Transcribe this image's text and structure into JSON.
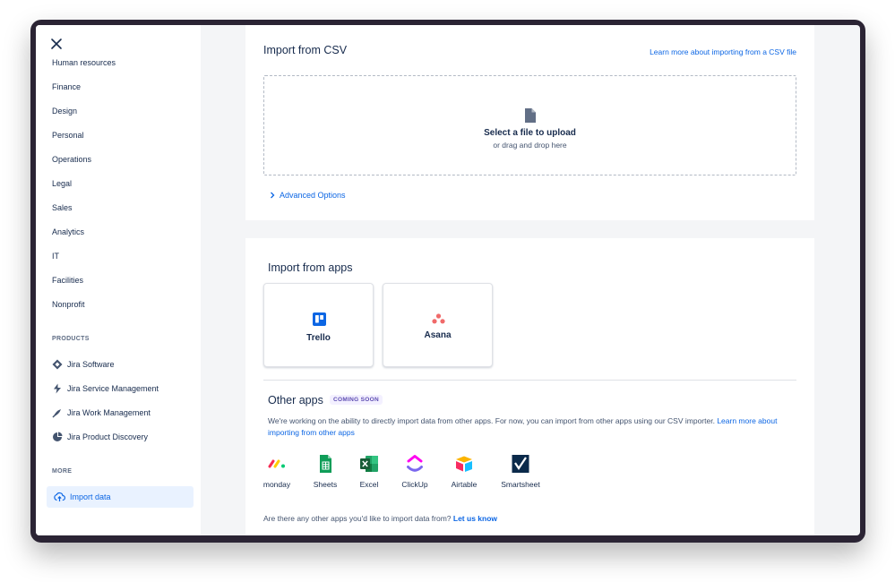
{
  "sidebar": {
    "categories": [
      {
        "label": "Human resources"
      },
      {
        "label": "Finance"
      },
      {
        "label": "Design"
      },
      {
        "label": "Personal"
      },
      {
        "label": "Operations"
      },
      {
        "label": "Legal"
      },
      {
        "label": "Sales"
      },
      {
        "label": "Analytics"
      },
      {
        "label": "IT"
      },
      {
        "label": "Facilities"
      },
      {
        "label": "Nonprofit"
      }
    ],
    "products_heading": "PRODUCTS",
    "products": [
      {
        "label": "Jira Software",
        "icon": "jira-software-icon"
      },
      {
        "label": "Jira Service Management",
        "icon": "jira-service-management-icon"
      },
      {
        "label": "Jira Work Management",
        "icon": "jira-work-management-icon"
      },
      {
        "label": "Jira Product Discovery",
        "icon": "jira-product-discovery-icon"
      }
    ],
    "more_heading": "MORE",
    "import_label": "Import data"
  },
  "csv": {
    "title": "Import from CSV",
    "learn_more": "Learn more about importing from a CSV file",
    "dropzone_title": "Select a file to upload",
    "dropzone_sub": "or drag and drop here",
    "advanced": "Advanced Options"
  },
  "apps": {
    "title": "Import from apps",
    "tiles": [
      {
        "label": "Trello",
        "icon": "trello-icon",
        "color": "#0c66e4"
      },
      {
        "label": "Asana",
        "icon": "asana-icon",
        "color": "#f06a6a"
      }
    ],
    "other_title": "Other apps",
    "coming_soon": "COMING SOON",
    "description": "We're working on the ability to directly import data from other apps. For now, you can import from other apps using our CSV importer.",
    "description_link": "Learn more about importing from other apps",
    "other_apps": [
      {
        "label": "monday",
        "icon": "monday-icon"
      },
      {
        "label": "Sheets",
        "icon": "google-sheets-icon"
      },
      {
        "label": "Excel",
        "icon": "excel-icon"
      },
      {
        "label": "ClickUp",
        "icon": "clickup-icon"
      },
      {
        "label": "Airtable",
        "icon": "airtable-icon"
      },
      {
        "label": "Smartsheet",
        "icon": "smartsheet-icon"
      }
    ],
    "ask_text": "Are there any other apps you'd like to import data from?",
    "ask_link": "Let us know"
  },
  "colors": {
    "link": "#0c66e4",
    "selected_bg": "#e9f2ff",
    "badge_bg": "#f3f0ff",
    "badge_text": "#5e4db2"
  }
}
